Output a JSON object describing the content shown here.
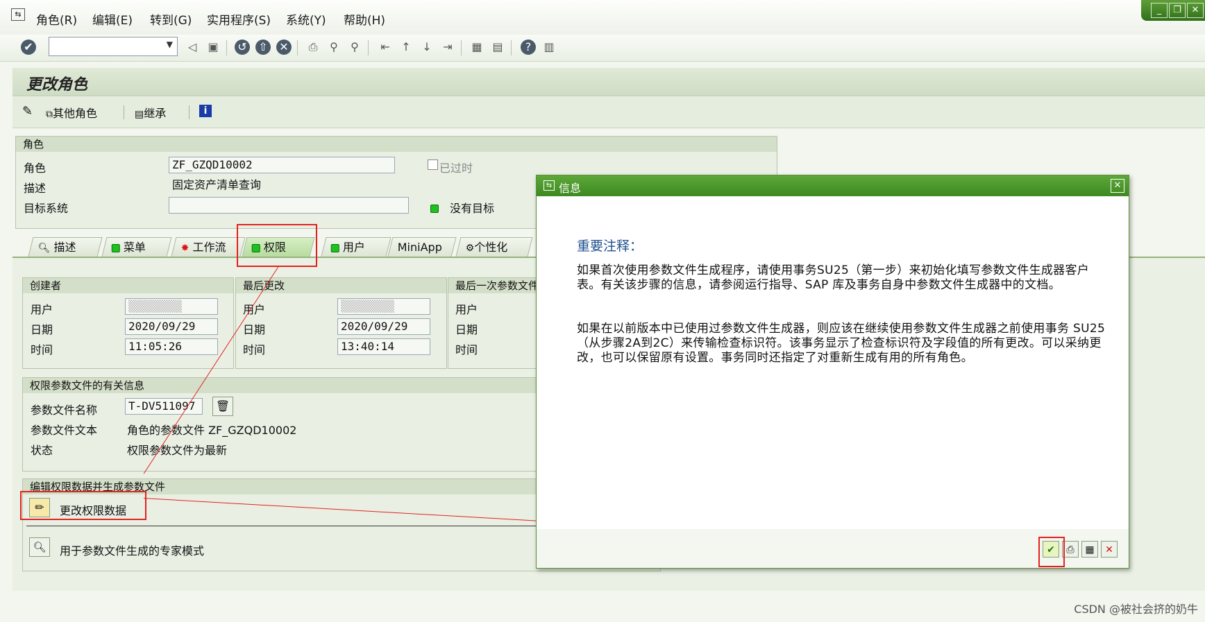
{
  "menubar": {
    "items": [
      "角色(R)",
      "编辑(E)",
      "转到(G)",
      "实用程序(S)",
      "系统(Y)",
      "帮助(H)"
    ]
  },
  "title": "更改角色",
  "app_toolbar": {
    "other_roles": "其他角色",
    "inherit": "继承"
  },
  "role": {
    "header": "角色",
    "role_label": "角色",
    "role_value": "ZF_GZQD10002",
    "obsolete_label": "已过时",
    "desc_label": "描述",
    "desc_value": "固定资产清单查询",
    "target_label": "目标系统",
    "target_value": "",
    "no_target": "没有目标"
  },
  "tabs": [
    "描述",
    "菜单",
    "工作流",
    "权限",
    "用户",
    "MiniApp",
    "个性化"
  ],
  "created": {
    "header": "创建者",
    "user_label": "用户",
    "date_label": "日期",
    "date_value": "2020/09/29",
    "time_label": "时间",
    "time_value": "11:05:26"
  },
  "changed": {
    "header": "最后更改",
    "user_label": "用户",
    "date_label": "日期",
    "date_value": "2020/09/29",
    "time_label": "时间",
    "time_value": "13:40:14"
  },
  "last_profile": {
    "header": "最后一次参数文件",
    "user_label": "用户",
    "date_label": "日期",
    "time_label": "时间"
  },
  "profile_info": {
    "header": "权限参数文件的有关信息",
    "name_label": "参数文件名称",
    "name_value": "T-DV511097",
    "text_label": "参数文件文本",
    "text_value": "角色的参数文件 ZF_GZQD10002",
    "status_label": "状态",
    "status_value": "权限参数文件为最新"
  },
  "edit_section": {
    "header": "编辑权限数据并生成参数文件",
    "change_btn": "更改权限数据",
    "expert_btn": "用于参数文件生成的专家模式"
  },
  "dialog": {
    "title": "信息",
    "note_heading": "重要注释：",
    "para1": "如果首次使用参数文件生成程序，请使用事务SU25（第一步）来初始化填写参数文件生成器客户表。有关该步骤的信息，请参阅运行指导、SAP 库及事务自身中参数文件生成器中的文档。",
    "para2": "如果在以前版本中已使用过参数文件生成器，则应该在继续使用参数文件生成器之前使用事务 SU25（从步骤2A到2C）来传输检查标识符。该事务显示了检查标识符及字段值的所有更改。可以采纳更改，也可以保留原有设置。事务同时还指定了对重新生成有用的所有角色。"
  },
  "watermark": "CSDN @被社会挤的奶牛",
  "colors": {
    "accent_green": "#3d8a20",
    "highlight_red": "#e32020",
    "note_blue": "#1e4f8c"
  }
}
